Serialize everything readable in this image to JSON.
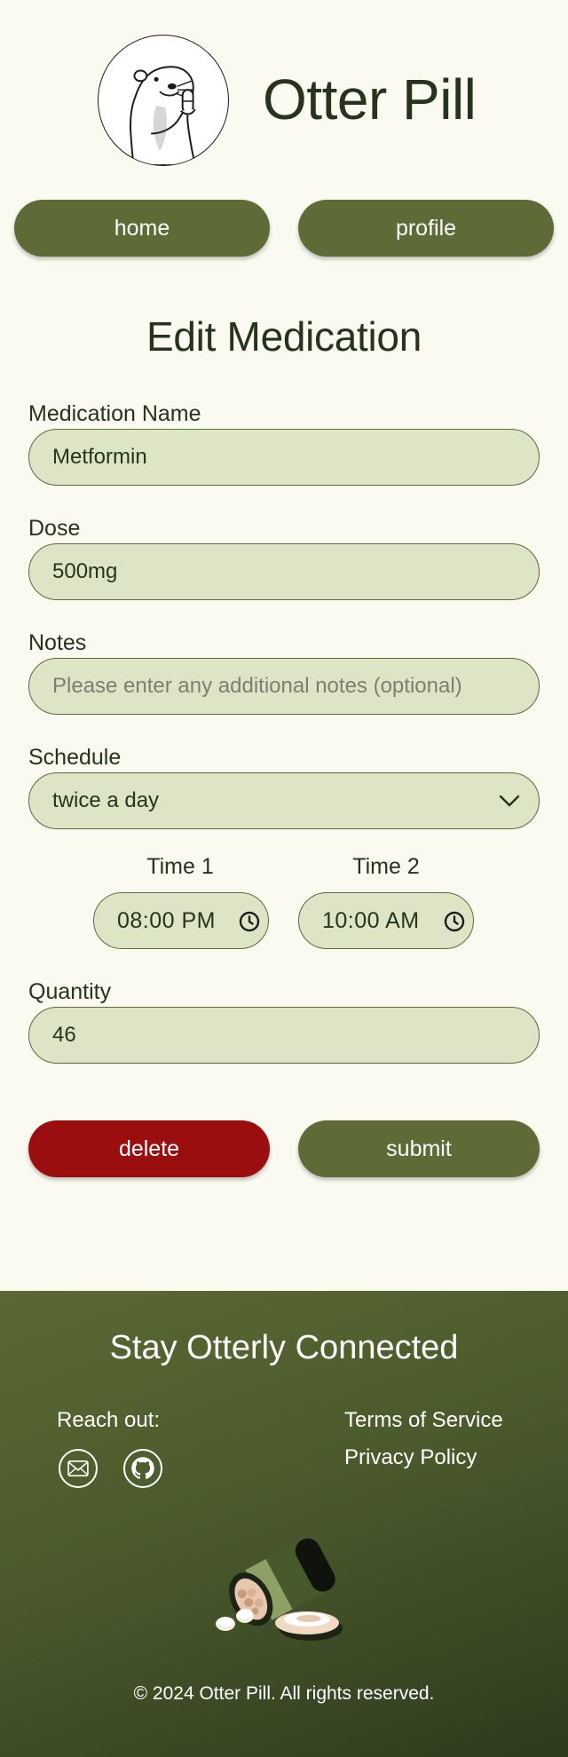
{
  "header": {
    "app_title": "Otter Pill",
    "logo_icon": "otter-holding-pill-logo"
  },
  "nav": {
    "home_label": "home",
    "profile_label": "profile"
  },
  "form": {
    "title": "Edit Medication",
    "medication_name": {
      "label": "Medication Name",
      "value": "Metformin"
    },
    "dose": {
      "label": "Dose",
      "value": "500mg"
    },
    "notes": {
      "label": "Notes",
      "value": "",
      "placeholder": "Please enter any additional notes (optional)"
    },
    "schedule": {
      "label": "Schedule",
      "value": "twice a day"
    },
    "times": [
      {
        "label": "Time 1",
        "value": "08:00 PM"
      },
      {
        "label": "Time 2",
        "value": "10:00 AM"
      }
    ],
    "quantity": {
      "label": "Quantity",
      "value": "46"
    },
    "delete_label": "delete",
    "submit_label": "submit"
  },
  "footer": {
    "title": "Stay Otterly Connected",
    "reach_out_label": "Reach out:",
    "social_icons": [
      "mail-icon",
      "github-icon"
    ],
    "links": [
      "Terms of Service",
      "Privacy Policy"
    ],
    "copyright": "© 2024 Otter Pill. All rights reserved."
  },
  "colors": {
    "background": "#fafaf0",
    "primary": "#5e6b37",
    "danger": "#9b0e0f",
    "input_bg": "#dde5c6",
    "text": "#26341b"
  }
}
